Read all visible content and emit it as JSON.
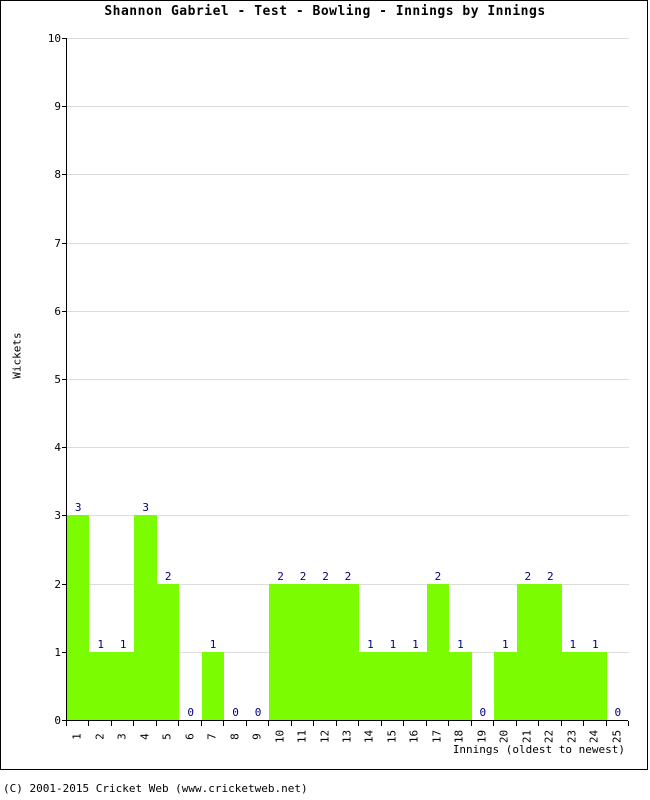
{
  "chart_data": {
    "type": "bar",
    "title": "Shannon Gabriel - Test - Bowling - Innings by Innings",
    "xlabel": "Innings (oldest to newest)",
    "ylabel": "Wickets",
    "ylim": [
      0,
      10
    ],
    "ytick_labels": [
      "0",
      "1",
      "2",
      "3",
      "4",
      "5",
      "6",
      "7",
      "8",
      "9",
      "10"
    ],
    "grid": true,
    "legend": false,
    "categories": [
      "1",
      "2",
      "3",
      "4",
      "5",
      "6",
      "7",
      "8",
      "9",
      "10",
      "11",
      "12",
      "13",
      "14",
      "15",
      "16",
      "17",
      "18",
      "19",
      "20",
      "21",
      "22",
      "23",
      "24",
      "25"
    ],
    "values": [
      3,
      1,
      1,
      3,
      2,
      0,
      1,
      0,
      0,
      2,
      2,
      2,
      2,
      1,
      1,
      1,
      2,
      1,
      0,
      1,
      2,
      2,
      1,
      1,
      0
    ],
    "data_labels": [
      "3",
      "1",
      "1",
      "3",
      "2",
      "0",
      "1",
      "0",
      "0",
      "2",
      "2",
      "2",
      "2",
      "1",
      "1",
      "1",
      "2",
      "1",
      "0",
      "1",
      "2",
      "2",
      "1",
      "1",
      "0"
    ],
    "bar_color": "#7CFC00",
    "label_color": "#000080",
    "grid_color": "#DCDCDC",
    "axis_color": "#000000"
  },
  "footer": {
    "copyright": "(C) 2001-2015 Cricket Web (www.cricketweb.net)"
  }
}
